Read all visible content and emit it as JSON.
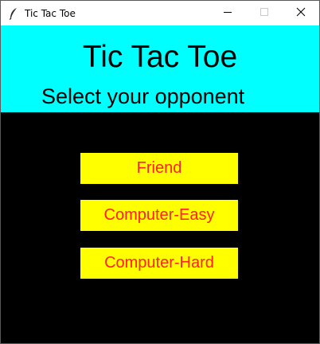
{
  "window": {
    "title": "Tic Tac Toe",
    "icon": "feather-icon",
    "controls": [
      "minimize-icon",
      "maximize-icon",
      "close-icon"
    ]
  },
  "header": {
    "title": "Tic Tac Toe",
    "subtitle": "Select your opponent",
    "background": "#00ffff"
  },
  "options": [
    {
      "label": "Friend"
    },
    {
      "label": "Computer-Easy"
    },
    {
      "label": "Computer-Hard"
    }
  ],
  "colors": {
    "canvas": "#000000",
    "button_bg": "#ffff00",
    "button_text": "#ff2020"
  }
}
